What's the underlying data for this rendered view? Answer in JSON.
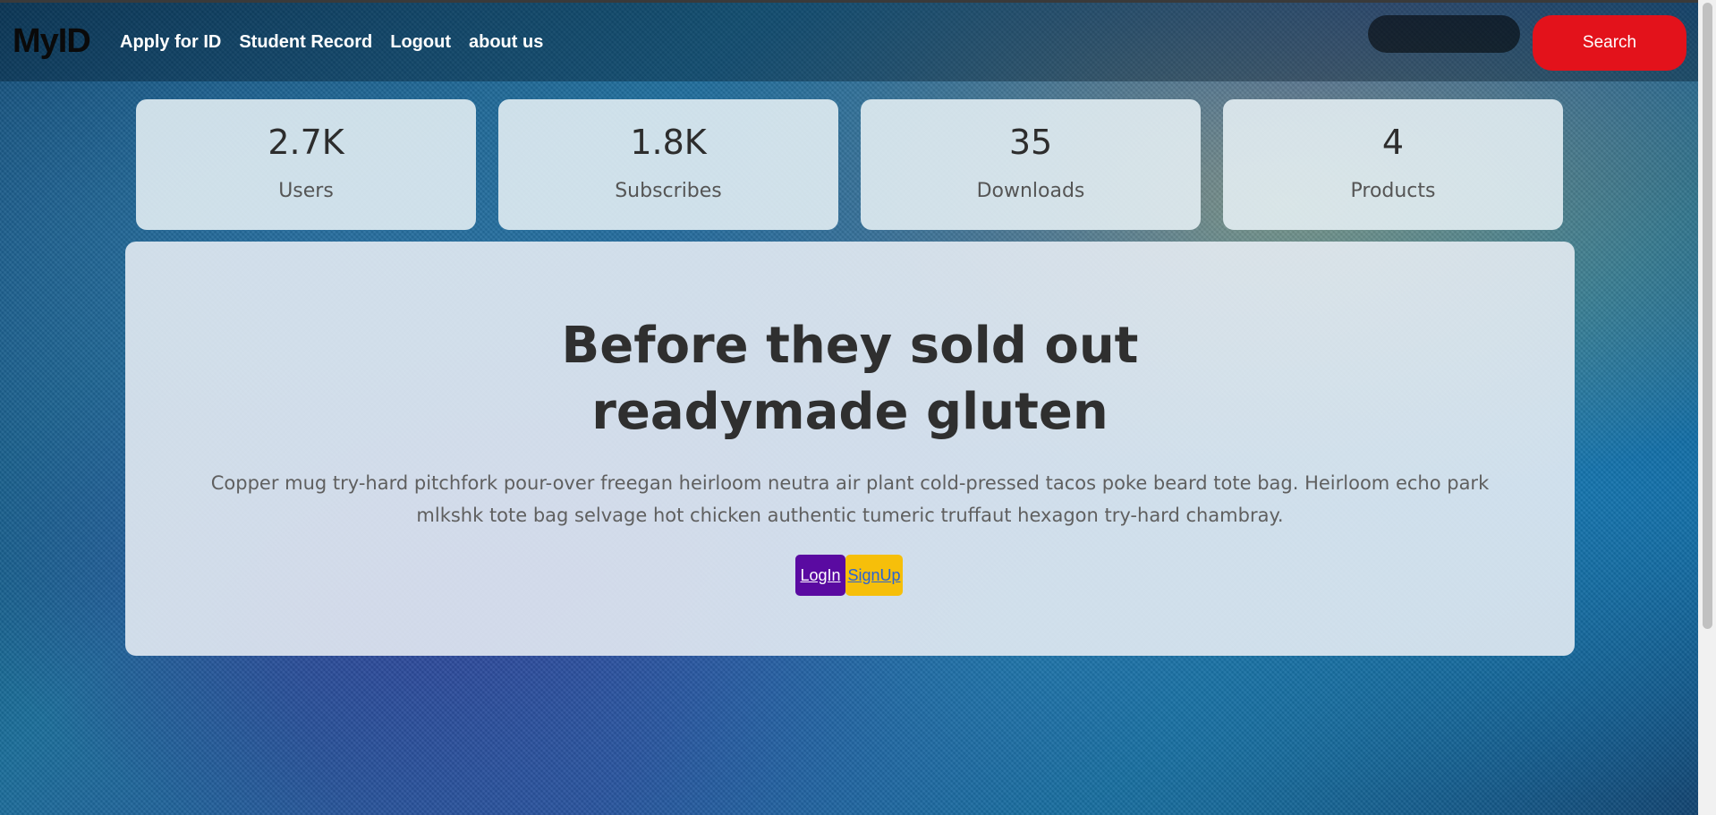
{
  "nav": {
    "brand": "MyID",
    "links": [
      "Apply for ID",
      "Student Record",
      "Logout",
      "about us"
    ],
    "search_button": "Search",
    "search_placeholder": ""
  },
  "stats": [
    {
      "value": "2.7K",
      "label": "Users"
    },
    {
      "value": "1.8K",
      "label": "Subscribes"
    },
    {
      "value": "35",
      "label": "Downloads"
    },
    {
      "value": "4",
      "label": "Products"
    }
  ],
  "hero": {
    "title_line1": "Before they sold out",
    "title_line2": "readymade gluten",
    "text": "Copper mug try-hard pitchfork pour-over freegan heirloom neutra air plant cold-pressed tacos poke beard tote bag. Heirloom echo park mlkshk tote bag selvage hot chicken authentic tumeric truffaut hexagon try-hard chambray.",
    "login_label": "LogIn",
    "signup_label": "SignUp"
  },
  "colors": {
    "search_button": "#e3121b",
    "login_button": "#5a0aa1",
    "signup_button": "#f6bf0a"
  }
}
